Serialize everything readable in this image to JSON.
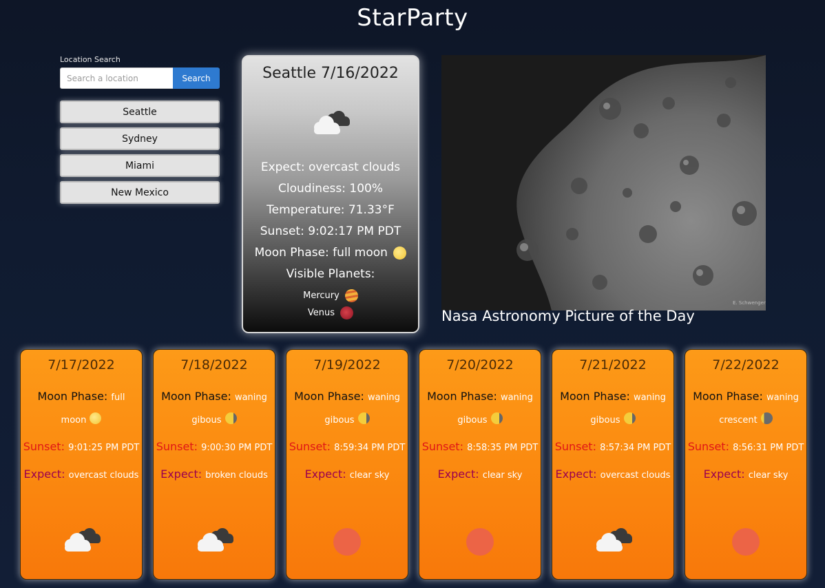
{
  "app_title": "StarParty",
  "search": {
    "label": "Location Search",
    "placeholder": "Search a location",
    "button_label": "Search"
  },
  "history": [
    {
      "label": "Seattle"
    },
    {
      "label": "Sydney"
    },
    {
      "label": "Miami"
    },
    {
      "label": "New Mexico"
    }
  ],
  "current": {
    "title": "Seattle 7/16/2022",
    "expect": "Expect: overcast clouds",
    "cloudiness": "Cloudiness: 100%",
    "temperature": "Temperature: 71.33°F",
    "sunset": "Sunset: 9:02:17 PM PDT",
    "moon_phase": "Moon Phase: full moon",
    "visible_planets_label": "Visible Planets:",
    "planets": [
      {
        "name": "Mercury",
        "color": "#f0a030"
      },
      {
        "name": "Venus",
        "color": "#c62a3a"
      }
    ]
  },
  "apod": {
    "caption": "Nasa Astronomy Picture of the Day",
    "credit": "E. Schwenger"
  },
  "forecast_labels": {
    "moon": "Moon Phase:",
    "sunset": "Sunset:",
    "expect": "Expect:"
  },
  "forecast": [
    {
      "date": "7/17/2022",
      "moon": "full moon",
      "moon_icon": "full-moon",
      "sunset": "9:01:25 PM PDT",
      "expect": "overcast clouds",
      "icon": "cloud"
    },
    {
      "date": "7/18/2022",
      "moon": "waning gibous",
      "moon_icon": "waning-gibbous",
      "sunset": "9:00:30 PM PDT",
      "expect": "broken clouds",
      "icon": "cloud"
    },
    {
      "date": "7/19/2022",
      "moon": "waning gibous",
      "moon_icon": "waning-gibbous",
      "sunset": "8:59:34 PM PDT",
      "expect": "clear sky",
      "icon": "sun"
    },
    {
      "date": "7/20/2022",
      "moon": "waning gibous",
      "moon_icon": "waning-gibbous",
      "sunset": "8:58:35 PM PDT",
      "expect": "clear sky",
      "icon": "sun"
    },
    {
      "date": "7/21/2022",
      "moon": "waning gibous",
      "moon_icon": "waning-gibbous",
      "sunset": "8:57:34 PM PDT",
      "expect": "overcast clouds",
      "icon": "cloud"
    },
    {
      "date": "7/22/2022",
      "moon": "waning crescent",
      "moon_icon": "waning-crescent",
      "sunset": "8:56:31 PM PDT",
      "expect": "clear sky",
      "icon": "sun"
    }
  ]
}
